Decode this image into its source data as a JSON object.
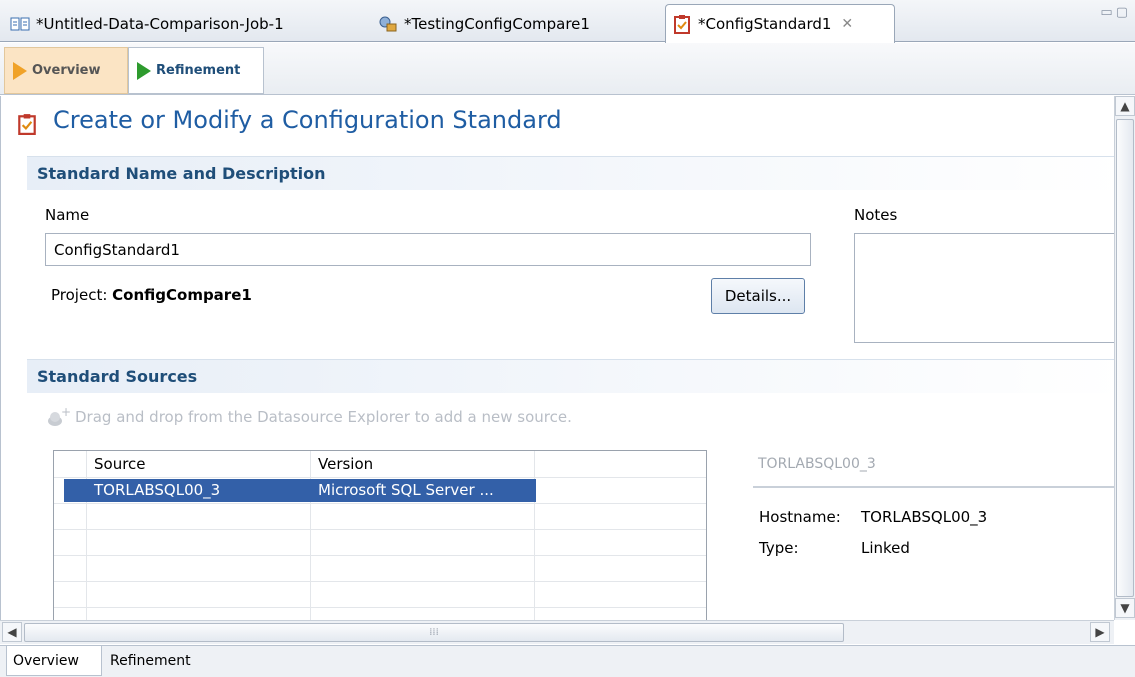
{
  "editor_tabs": [
    {
      "label": "*Untitled-Data-Comparison-Job-1",
      "icon": "data-comparison-icon"
    },
    {
      "label": "*TestingConfigCompare1",
      "icon": "config-compare-icon"
    },
    {
      "label": "*ConfigStandard1",
      "icon": "config-standard-icon",
      "active": true
    }
  ],
  "form_tabs": {
    "overview": "Overview",
    "refinement": "Refinement"
  },
  "page": {
    "title": "Create or Modify a Configuration Standard"
  },
  "section_name": {
    "title": "Standard Name and Description",
    "name_label": "Name",
    "name_value": "ConfigStandard1",
    "notes_label": "Notes",
    "project_label": "Project:",
    "project_value": "ConfigCompare1",
    "details_button": "Details..."
  },
  "section_sources": {
    "title": "Standard Sources",
    "drag_hint": "Drag and drop from the Datasource Explorer to add a new source.",
    "table": {
      "columns": [
        "Source",
        "Version"
      ],
      "rows": [
        {
          "source": "TORLABSQL00_3",
          "version": "Microsoft SQL Server ..."
        }
      ]
    },
    "info": {
      "title": "TORLABSQL00_3",
      "hostname_label": "Hostname:",
      "hostname_value": "TORLABSQL00_3",
      "type_label": "Type:",
      "type_value": "Linked"
    }
  },
  "bottom_tabs": [
    "Overview",
    "Refinement"
  ],
  "colors": {
    "title_blue": "#1f5da3",
    "section_blue": "#1f4e79",
    "selection": "#3360a8"
  }
}
